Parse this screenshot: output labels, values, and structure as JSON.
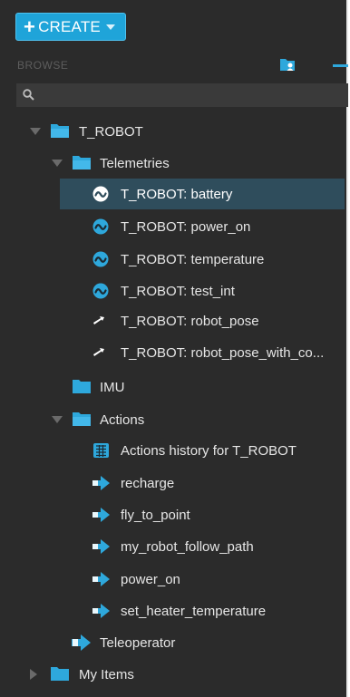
{
  "toolbar": {
    "create_label": "CREATE"
  },
  "browse": {
    "label": "BROWSE"
  },
  "search": {
    "value": "",
    "placeholder": ""
  },
  "tree": {
    "root": "T_ROBOT",
    "telemetries": "Telemetries",
    "telemetry_items": [
      "T_ROBOT: battery",
      "T_ROBOT: power_on",
      "T_ROBOT: temperature",
      "T_ROBOT: test_int",
      "T_ROBOT: robot_pose",
      "T_ROBOT: robot_pose_with_co..."
    ],
    "imu": "IMU",
    "actions": "Actions",
    "action_items": [
      "Actions history for T_ROBOT",
      "recharge",
      "fly_to_point",
      "my_robot_follow_path",
      "power_on",
      "set_heater_temperature"
    ],
    "teleoperator": "Teleoperator",
    "my_items": "My Items"
  },
  "colors": {
    "accent": "#1fa4d9",
    "panel_bg": "#2b2b2b",
    "selected_bg": "#2f4d5c"
  }
}
